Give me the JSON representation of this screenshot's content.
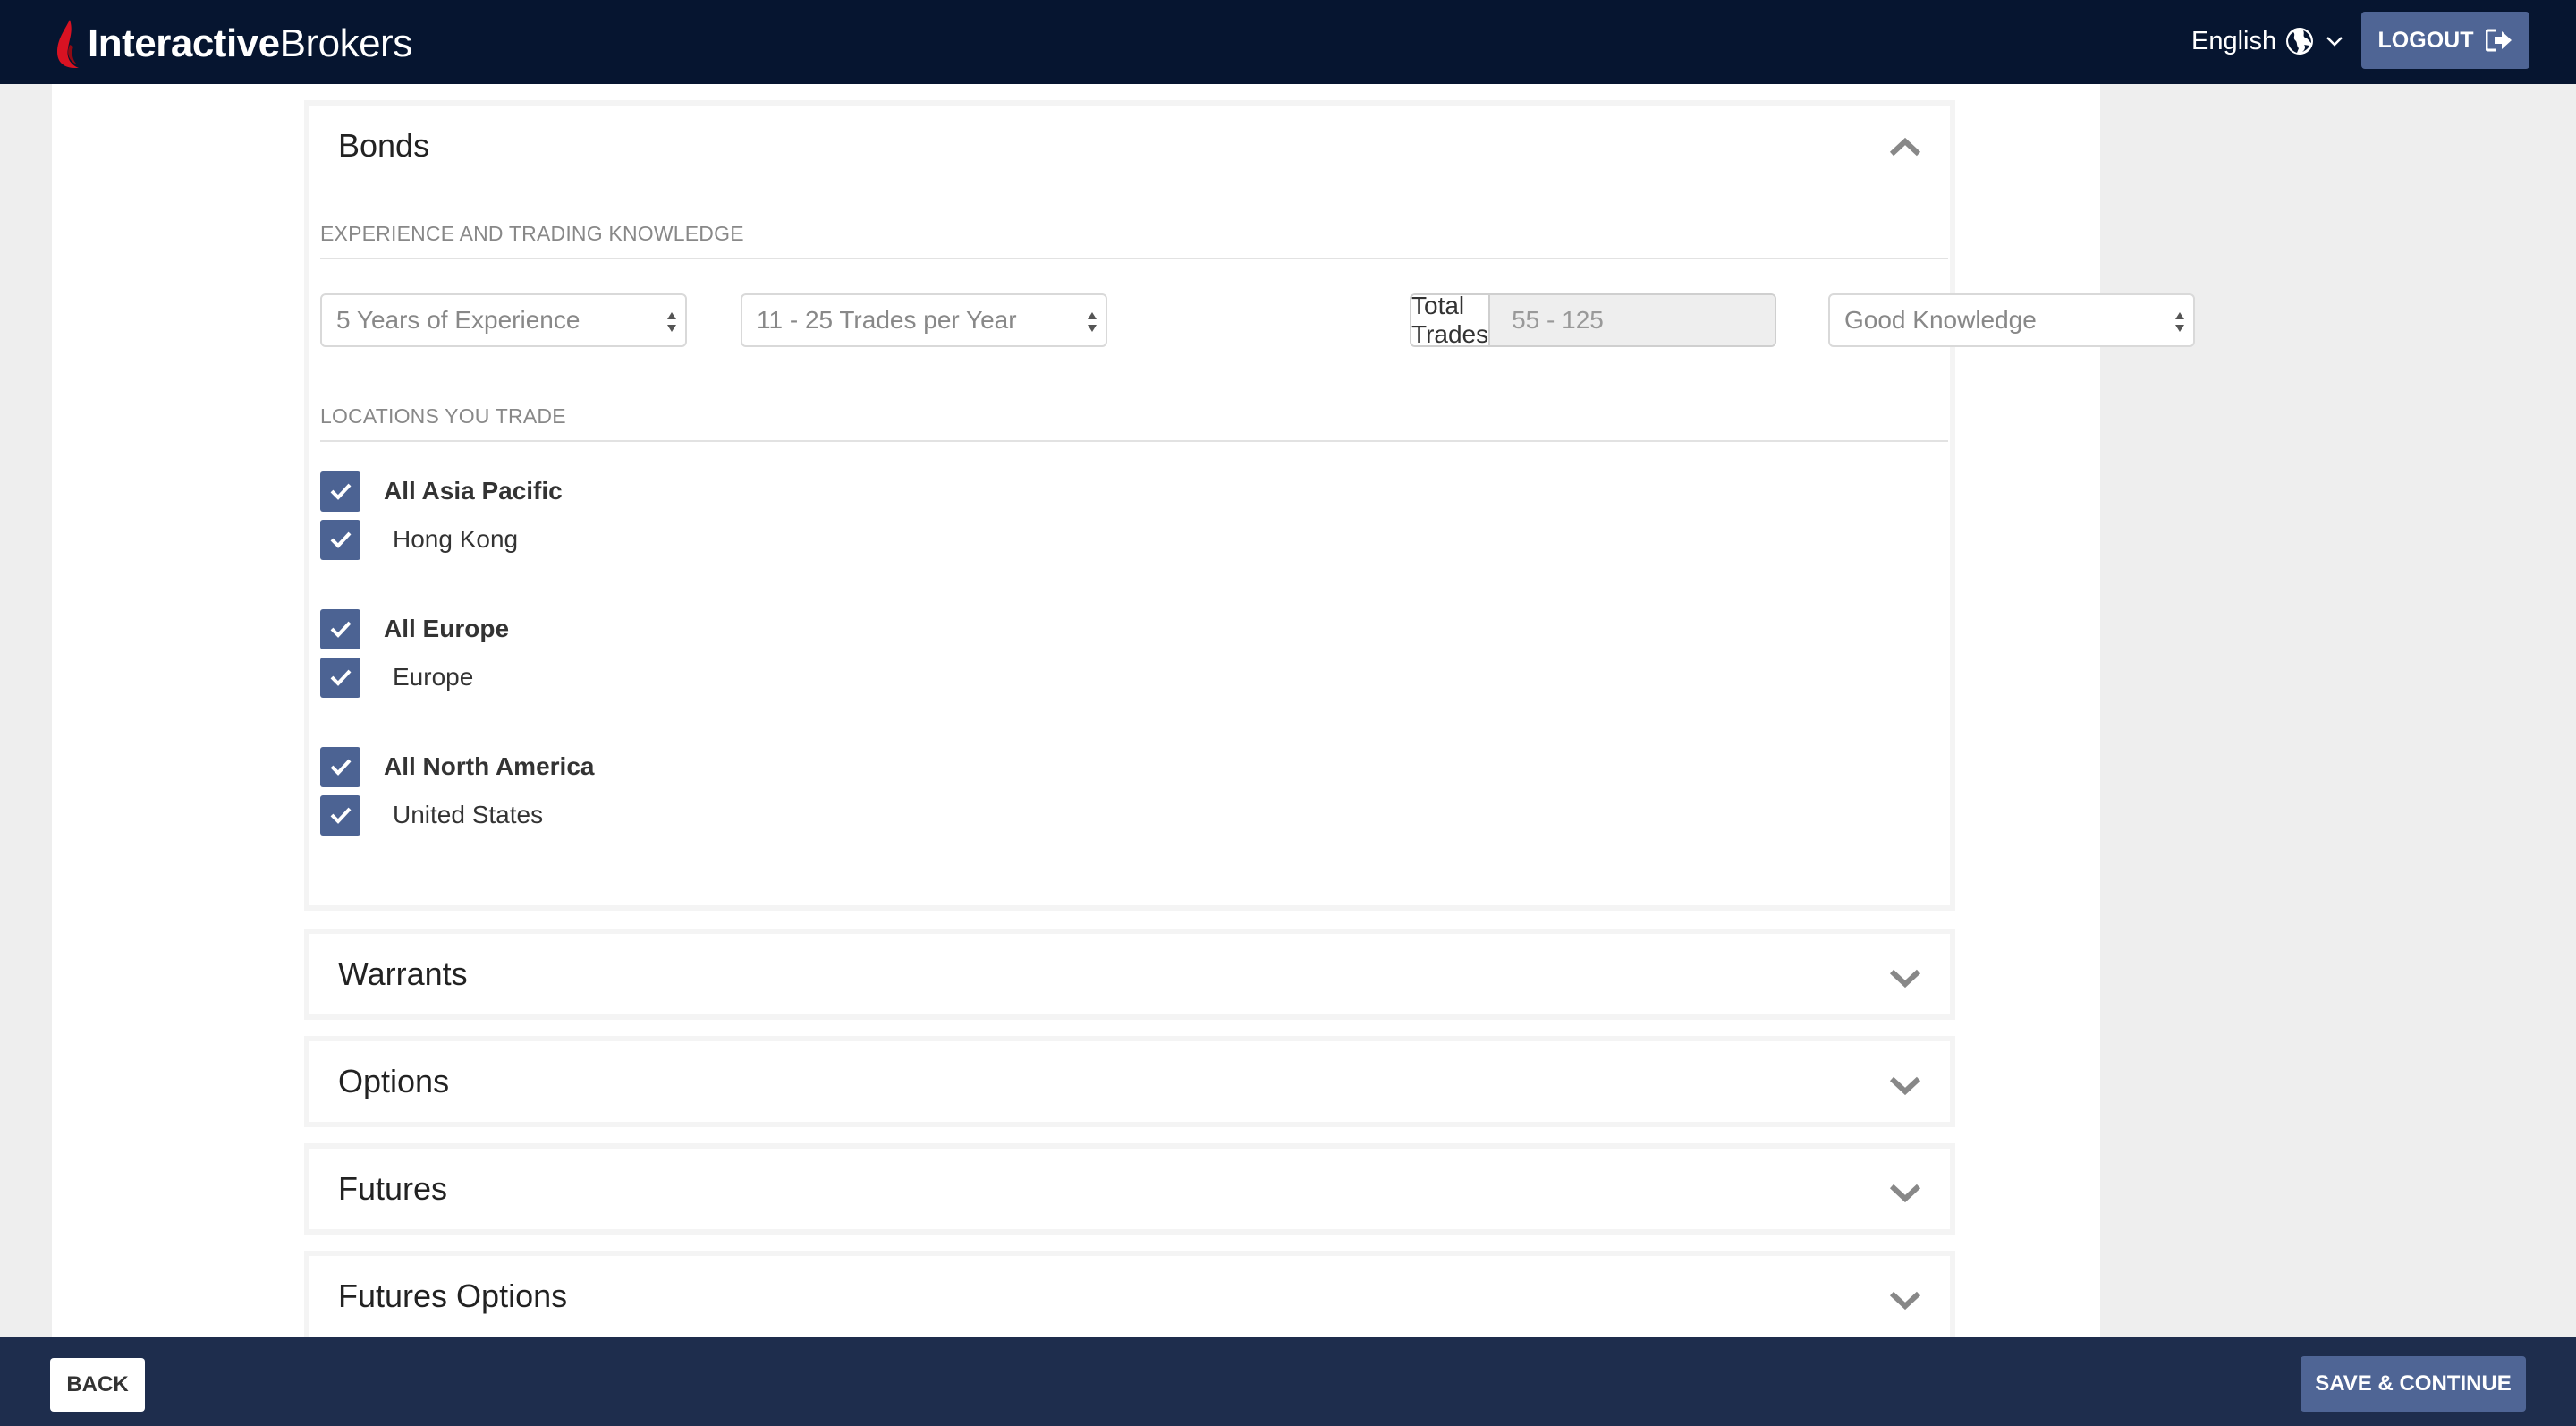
{
  "header": {
    "brand_bold": "Interactive",
    "brand_light": "Brokers",
    "language": "English",
    "logout_label": "LOGOUT"
  },
  "bonds": {
    "title": "Bonds",
    "experience_label": "EXPERIENCE AND TRADING KNOWLEDGE",
    "years_select": "5 Years of Experience",
    "trades_select": "11 - 25 Trades per Year",
    "total_trades_label": "Total Trades",
    "total_trades_value": "55 - 125",
    "knowledge_select": "Good Knowledge",
    "locations_label": "LOCATIONS YOU TRADE",
    "locations": [
      {
        "group": "All Asia Pacific",
        "items": [
          "Hong Kong"
        ]
      },
      {
        "group": "All Europe",
        "items": [
          "Europe"
        ]
      },
      {
        "group": "All North America",
        "items": [
          "United States"
        ]
      }
    ]
  },
  "collapsed_sections": [
    "Warrants",
    "Options",
    "Futures",
    "Futures Options"
  ],
  "footer": {
    "back_label": "BACK",
    "save_label": "SAVE & CONTINUE"
  },
  "colors": {
    "nav_bg": "#061530",
    "footer_bg": "#1e2d4d",
    "accent": "#4f6595",
    "checkbox": "#4c6393"
  }
}
